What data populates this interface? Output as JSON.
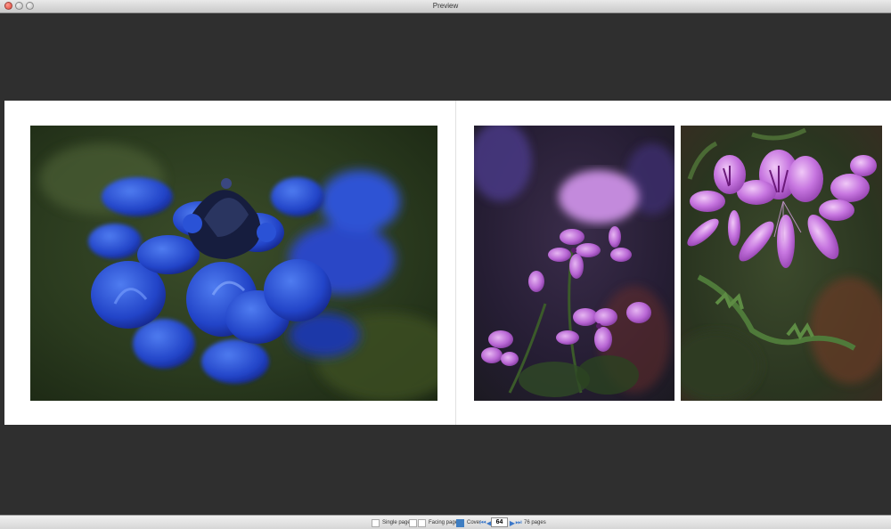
{
  "window": {
    "title": "Preview"
  },
  "toolbar": {
    "single_page_label": "Single page",
    "facing_pages_label": "Facing pages",
    "cover_label": "Cover",
    "current_page": "64",
    "total_pages_label": "76 pages"
  },
  "photos": [
    {
      "subject": "blue flower macro"
    },
    {
      "subject": "purple geranium flowers"
    },
    {
      "subject": "purple geranium flowers close-up"
    }
  ],
  "colors": {
    "accent": "#3a77c9",
    "background": "#2f2f2f"
  }
}
